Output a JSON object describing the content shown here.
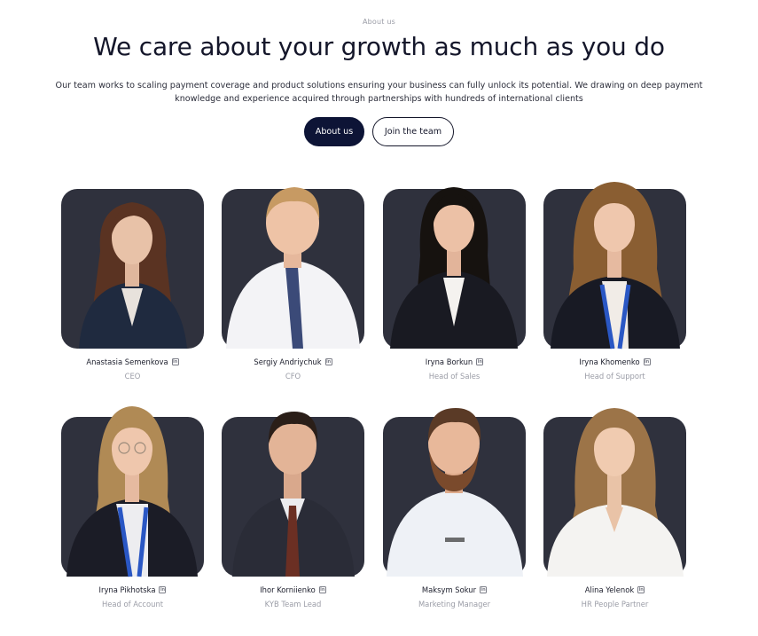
{
  "header": {
    "eyebrow": "About us",
    "title": "We care about your growth as much as you do",
    "subtitle": "Our team works to scaling payment coverage and product solutions ensuring your business can fully unlock its potential. We drawing on deep payment knowledge and experience acquired through partnerships with hundreds of international clients"
  },
  "buttons": {
    "about": "About us",
    "join": "Join the team"
  },
  "team": [
    {
      "name": "Anastasia Semenkova",
      "role": "CEO"
    },
    {
      "name": "Sergiy Andriychuk",
      "role": "CFO"
    },
    {
      "name": "Iryna Borkun",
      "role": "Head of Sales"
    },
    {
      "name": "Iryna Khomenko",
      "role": "Head of Support"
    },
    {
      "name": "Iryna Pikhotska",
      "role": "Head of Account"
    },
    {
      "name": "Ihor Korniienko",
      "role": "KYB Team Lead"
    },
    {
      "name": "Maksym Sokur",
      "role": "Marketing Manager"
    },
    {
      "name": "Alina Yelenok",
      "role": "HR People Partner"
    }
  ],
  "icons": {
    "profile": "linkedin-icon"
  },
  "colors": {
    "primary_button": "#0d1436",
    "photo_background": "#2f313d",
    "role_text": "#9a9ca6"
  }
}
